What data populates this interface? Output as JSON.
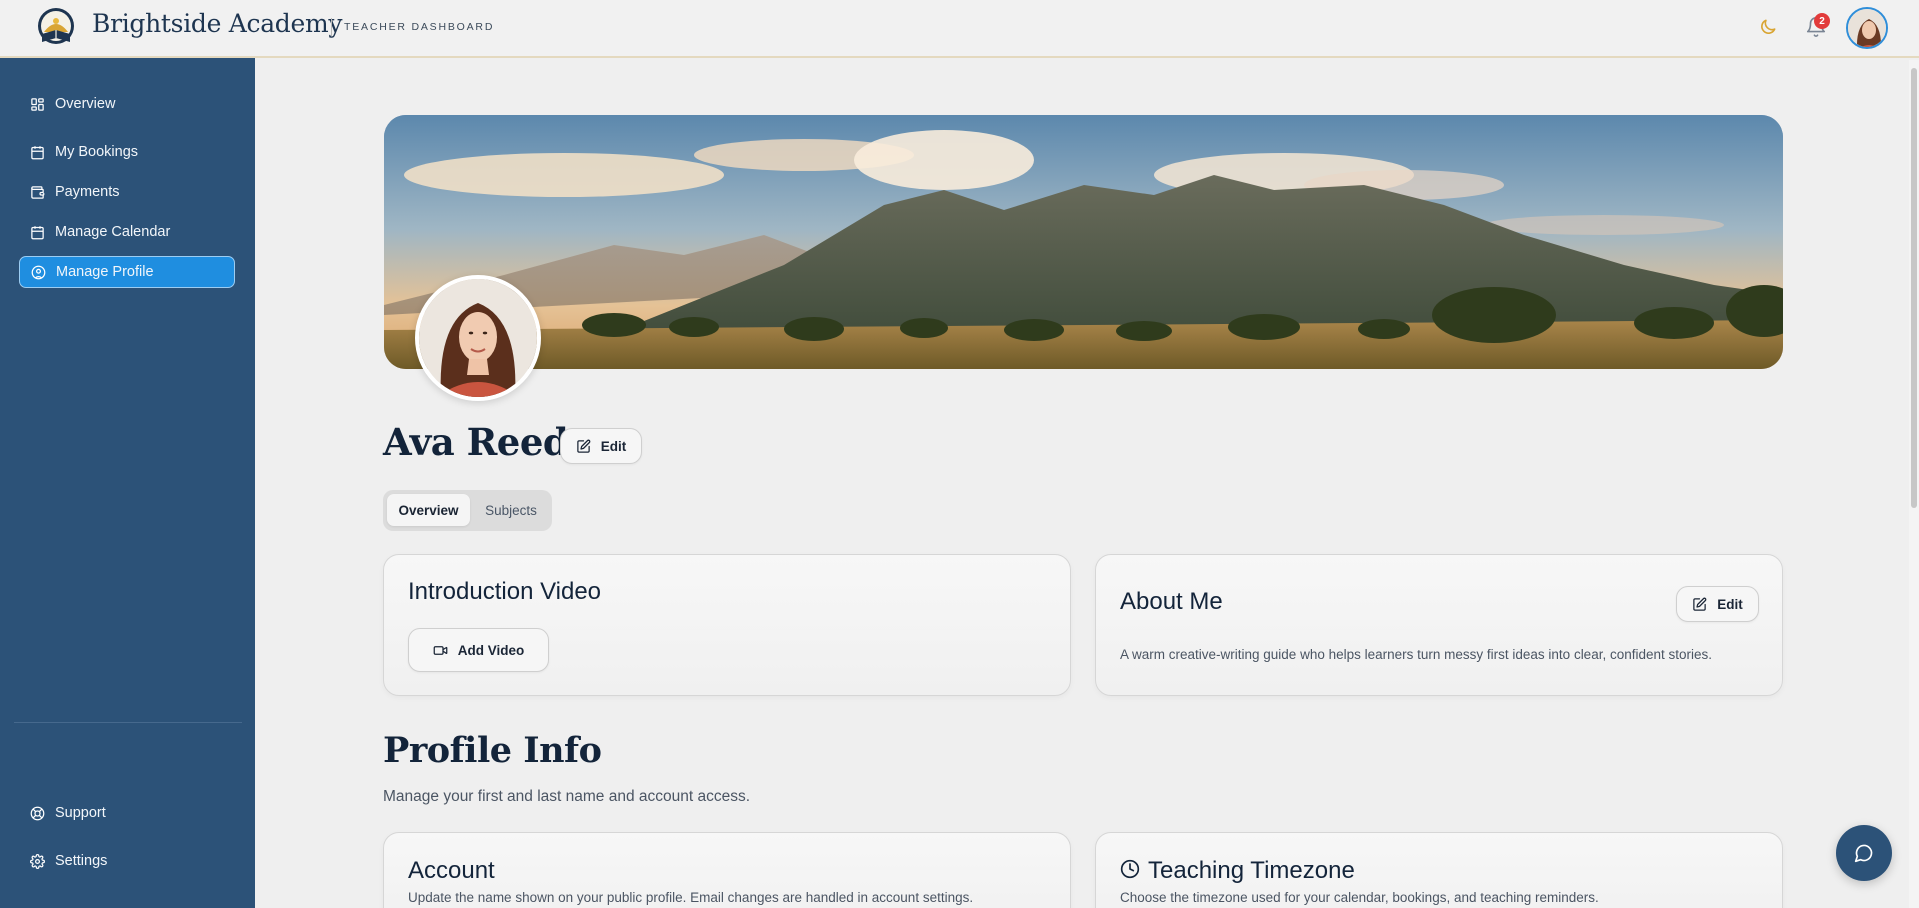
{
  "header": {
    "brand": "Brightside Academy",
    "subtitle": "TEACHER DASHBOARD",
    "notification_count": "2"
  },
  "sidebar": {
    "items": [
      {
        "label": "Overview",
        "icon": "grid-icon"
      },
      {
        "label": "My Bookings",
        "icon": "calendar-icon"
      },
      {
        "label": "Payments",
        "icon": "wallet-icon"
      },
      {
        "label": "Manage Calendar",
        "icon": "calendar-icon"
      },
      {
        "label": "Manage Profile",
        "icon": "user-circle-icon",
        "active": true
      }
    ],
    "bottom": [
      {
        "label": "Support",
        "icon": "support-icon"
      },
      {
        "label": "Settings",
        "icon": "gear-icon"
      }
    ]
  },
  "profile": {
    "name": "Ava Reed",
    "edit_label": "Edit",
    "tabs": [
      "Overview",
      "Subjects"
    ],
    "selected_tab": "Overview"
  },
  "intro_video": {
    "title": "Introduction Video",
    "button": "Add Video"
  },
  "about": {
    "title": "About Me",
    "edit_label": "Edit",
    "text": "A warm creative-writing guide who helps learners turn messy first ideas into clear, confident stories."
  },
  "profile_info": {
    "title": "Profile Info",
    "subtitle": "Manage your first and last name and account access."
  },
  "account": {
    "title": "Account",
    "text": "Update the name shown on your public profile. Email changes are handled in account settings."
  },
  "timezone": {
    "title": "Teaching Timezone",
    "text": "Choose the timezone used for your calendar, bookings, and teaching reminders."
  },
  "colors": {
    "sidebar": "#2c5278",
    "active": "#1f8ee0",
    "accent": "#e4d9bf"
  }
}
